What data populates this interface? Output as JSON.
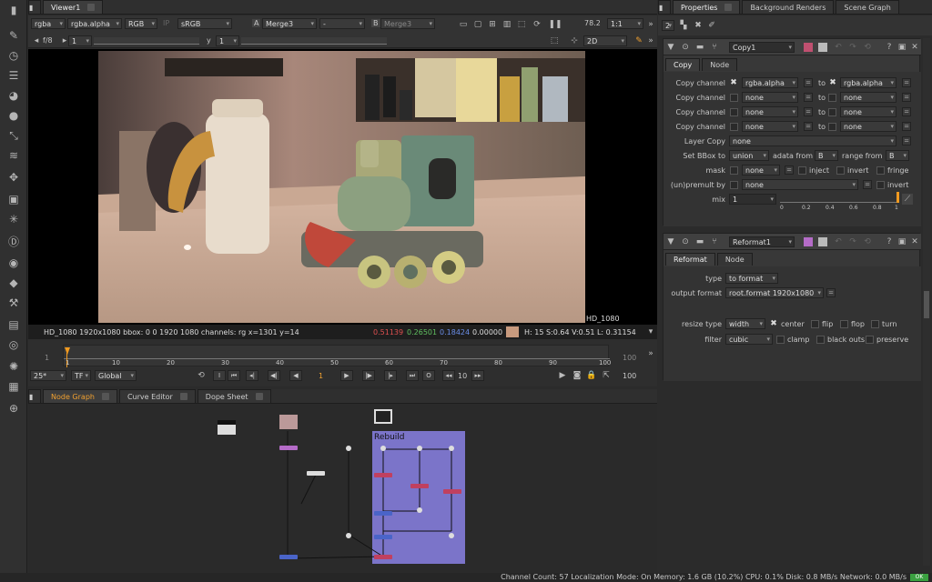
{
  "viewer": {
    "tab": "Viewer1",
    "channels": "rgba",
    "alpha": "rgba.alpha",
    "colorspace": "RGB",
    "ip": "IP",
    "lut": "sRGB",
    "a_label": "A",
    "a_input": "Merge3",
    "b_label": "B",
    "b_input": "Merge3",
    "dash": "-",
    "zoom": "78.2",
    "ratio": "1:1",
    "fstop": "f/8",
    "fvalue": "1",
    "y_label": "y",
    "y_value": "1",
    "view_mode": "2D",
    "format_label": "HD_1080",
    "status_left": "HD_1080  1920x1080  bbox: 0 0 1920 1080 channels: rg  x=1301 y=14",
    "r_val": "0.51139",
    "g_val": "0.26501",
    "b_val": "0.18424",
    "a_val": "0.00000",
    "hsv": "H: 15 S:0.64 V:0.51  L: 0.31154",
    "swatch_color": "#c89a7e"
  },
  "timeline": {
    "left_frame": "1",
    "right_frame": "100",
    "ticks": [
      "1",
      "10",
      "20",
      "30",
      "40",
      "50",
      "60",
      "70",
      "80",
      "90",
      "100"
    ],
    "fps": "25*",
    "tf": "TF",
    "scope": "Global",
    "current_frame": "1",
    "step": "10",
    "end_frame": "100"
  },
  "node_graph": {
    "tabs": [
      "Node Graph",
      "Curve Editor",
      "Dope Sheet"
    ],
    "backdrop_label": "Rebuild",
    "backdrop_color": "#7b74c9"
  },
  "properties": {
    "tabs": [
      "Properties",
      "Background Renders",
      "Scene Graph"
    ],
    "count": "2",
    "copy_node": {
      "name": "Copy1",
      "tabs": [
        "Copy",
        "Node"
      ],
      "copy_rows": [
        {
          "label": "Copy channel",
          "from": "rgba.alpha",
          "to_label": "to",
          "to": "rgba.alpha"
        },
        {
          "label": "Copy channel",
          "from": "none",
          "to_label": "to",
          "to": "none"
        },
        {
          "label": "Copy channel",
          "from": "none",
          "to_label": "to",
          "to": "none"
        },
        {
          "label": "Copy channel",
          "from": "none",
          "to_label": "to",
          "to": "none"
        }
      ],
      "layer_copy_label": "Layer Copy",
      "layer_copy": "none",
      "bbox_label": "Set BBox to",
      "bbox": "union",
      "adata_label": "adata from",
      "adata": "B",
      "range_label": "range from",
      "range": "B",
      "mask_label": "mask",
      "mask": "none",
      "inject": "inject",
      "invert": "invert",
      "fringe": "fringe",
      "premult_label": "(un)premult by",
      "premult": "none",
      "premult_invert": "invert",
      "mix_label": "mix",
      "mix": "1",
      "slider_ticks": [
        "0",
        "0.2",
        "0.4",
        "0.6",
        "0.8",
        "1"
      ]
    },
    "reformat_node": {
      "name": "Reformat1",
      "tabs": [
        "Reformat",
        "Node"
      ],
      "type_label": "type",
      "type": "to format",
      "format_label": "output format",
      "format": "root.format 1920x1080",
      "resize_label": "resize type",
      "resize": "width",
      "center": "center",
      "flip": "flip",
      "flop": "flop",
      "turn": "turn",
      "filter_label": "filter",
      "filter": "cubic",
      "clamp": "clamp",
      "black_outside": "black outs",
      "preserve": "preserve"
    }
  },
  "statusbar": "Channel Count: 57  Localization Mode: On  Memory: 1.6 GB (10.2%)  CPU: 0.1%  Disk: 0.8 MB/s  Network: 0.0 MB/s",
  "status_badge": "OK",
  "icons": [
    "pen-icon",
    "timer-icon",
    "layers-icon",
    "color-wheel-icon",
    "sphere-icon",
    "transform-icon",
    "stack-icon",
    "move-icon",
    "cube-icon",
    "particle-icon",
    "d-icon",
    "eye-icon",
    "tag-icon",
    "wrench-icon",
    "panel-icon",
    "flame-icon",
    "sparkle-icon",
    "globe-icon"
  ]
}
